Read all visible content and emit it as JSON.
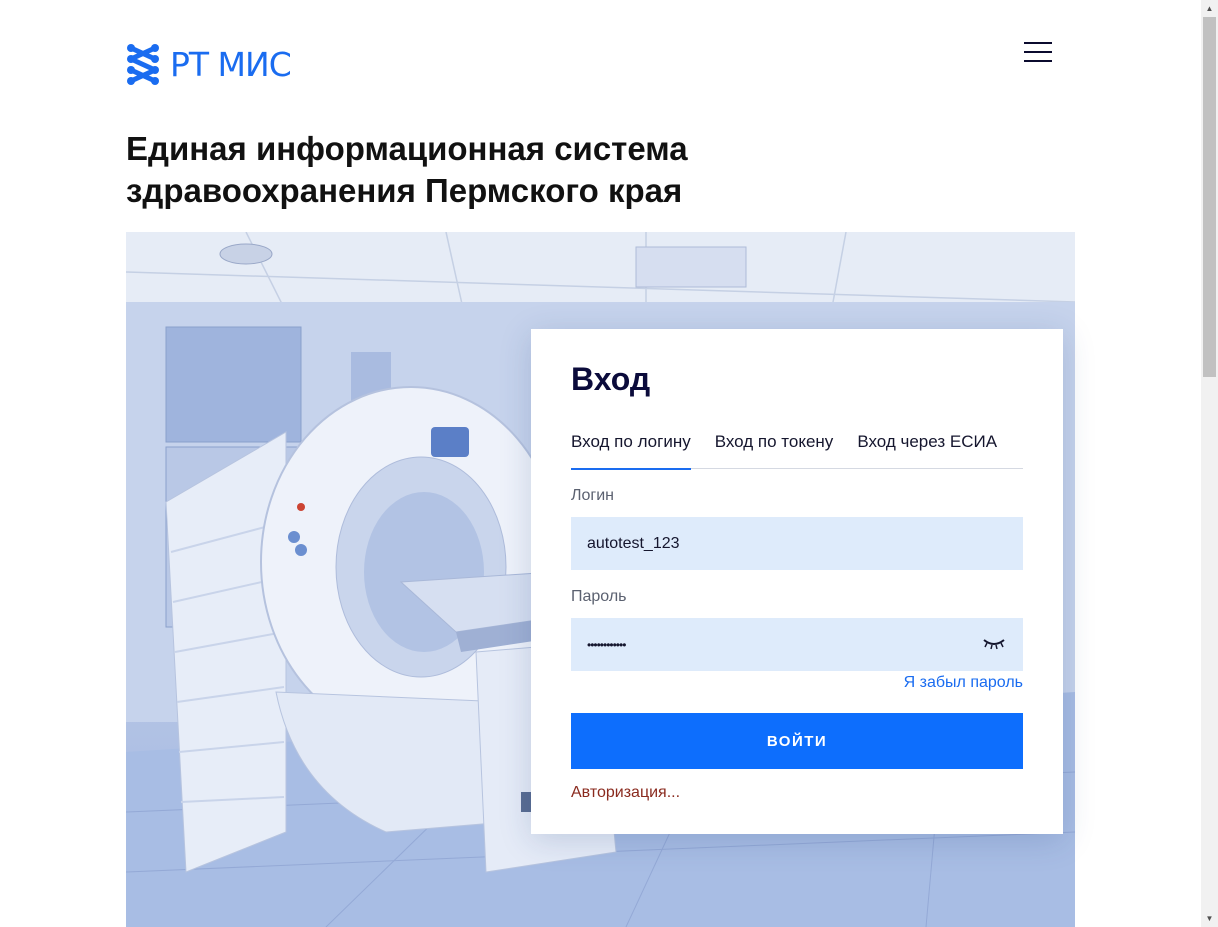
{
  "header": {
    "logo_text": "РТ МИС",
    "logo_color": "#1a6cf0",
    "menu_icon": "hamburger-menu-icon"
  },
  "page": {
    "title": "Единая информационная система здравоохранения Пермского края"
  },
  "login": {
    "title": "Вход",
    "tabs": [
      {
        "label": "Вход по логину",
        "active": true
      },
      {
        "label": "Вход по токену",
        "active": false
      },
      {
        "label": "Вход через ЕСИА",
        "active": false
      }
    ],
    "login_label": "Логин",
    "login_value": "autotest_123",
    "password_label": "Пароль",
    "password_value": "••••••••••••",
    "password_toggle_icon": "eye-closed-icon",
    "forgot_link": "Я забыл пароль",
    "submit_label": "ВОЙТИ",
    "status_text": "Авторизация...",
    "accent_color": "#0d6efd",
    "status_color": "#8a2a1e"
  },
  "hero": {
    "image": "ct-scanner-room-photo"
  }
}
